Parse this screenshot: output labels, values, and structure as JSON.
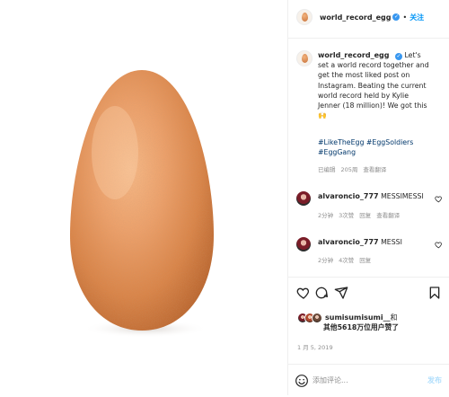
{
  "post": {
    "username": "world_record_egg",
    "follow_label": "关注",
    "caption": "Let's set a world record together and get the most liked post on Instagram. Beating the current world record held by Kylie Jenner (18 million)! We got this 🙌",
    "hashtags": "#LikeTheEgg #EggSoldiers #EggGang",
    "caption_meta": {
      "edited": "已编辑",
      "time": "205周",
      "see_translation": "查看翻译"
    },
    "comments": [
      {
        "username": "alvaroncio_777",
        "text": "MESSIMESSI",
        "time": "2分钟",
        "likes": "3次赞",
        "reply": "回复",
        "see_translation": "查看翻译"
      },
      {
        "username": "alvaroncio_777",
        "text": "MESSI",
        "time": "2分钟",
        "likes": "4次赞",
        "reply": "回复"
      }
    ],
    "likes": {
      "first_user": "sumisumisumi__",
      "and": "和",
      "others": "其他5618万位用户赞了"
    },
    "date": "1 月 5, 2019",
    "add_comment_placeholder": "添加评论...",
    "post_button": "发布"
  },
  "colors": {
    "verified": "#3897f0",
    "follow": "#0095f6",
    "hashtag": "#00376b",
    "secondary_text": "#8e8e8e",
    "post_button_disabled": "#b2dffc"
  },
  "icons": [
    "egg-image",
    "verified-badge-icon",
    "heart-icon",
    "comment-icon",
    "share-icon",
    "bookmark-icon",
    "emoji-icon",
    "raised-hands-emoji"
  ]
}
